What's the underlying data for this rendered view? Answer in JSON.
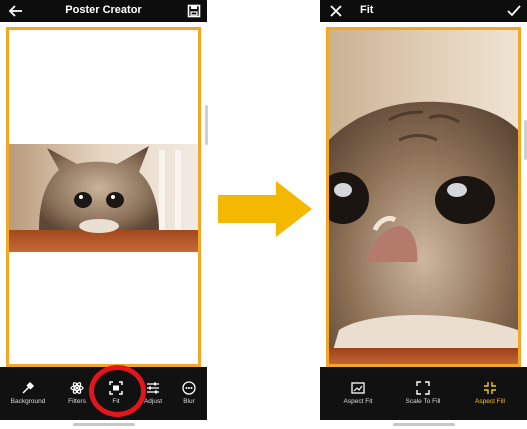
{
  "left_screen": {
    "title": "Poster Creator",
    "back_icon": "back-arrow-icon",
    "save_icon": "save-icon",
    "tools": [
      {
        "label": "Background",
        "icon": "eyedropper-icon"
      },
      {
        "label": "Filters",
        "icon": "filters-icon"
      },
      {
        "label": "Fit",
        "icon": "fit-icon",
        "highlighted": true
      },
      {
        "label": "Adjust",
        "icon": "sliders-icon"
      },
      {
        "label": "Blur",
        "icon": "blur-icon"
      }
    ]
  },
  "right_screen": {
    "title": "Fit",
    "close_icon": "close-icon",
    "confirm_icon": "checkmark-icon",
    "tools": [
      {
        "label": "Aspect Fit",
        "icon": "aspect-fit-icon"
      },
      {
        "label": "Scale To Fill",
        "icon": "scale-to-fill-icon"
      },
      {
        "label": "Aspect Fill",
        "icon": "aspect-fill-icon",
        "active": true
      }
    ]
  },
  "colors": {
    "accent": "#f5a623",
    "active_label": "#f5c518",
    "highlight_circle": "#e4151a",
    "arrow": "#f5b800",
    "bar": "#0d0d0d"
  }
}
